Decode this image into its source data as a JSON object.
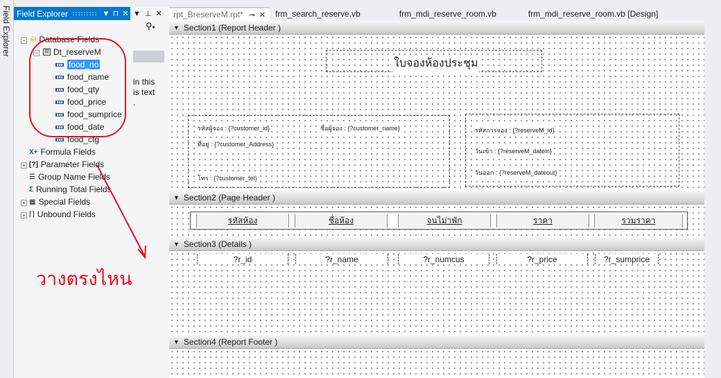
{
  "side_tab": {
    "label": "Field Explorer"
  },
  "field_explorer": {
    "title": "Field Explorer",
    "database_fields": "Database Fields",
    "table": "Dt_reserveM",
    "fields": [
      "food_no",
      "food_name",
      "food_qty",
      "food_price",
      "food_sumprice",
      "food_date",
      "food_ctg"
    ],
    "formula_fields": "Formula Fields",
    "parameter_fields": "Parameter Fields",
    "group_name_fields": "Group Name Fields",
    "running_total_fields": "Running Total Fields",
    "special_fields": "Special Fields",
    "unbound_fields": "Unbound Fields"
  },
  "annotation": {
    "text": "วางตรงไหน",
    "color": "#e81123"
  },
  "middle_panel": {
    "text_lines": "in this\nis text\n."
  },
  "tabs": [
    {
      "label": "rpt_BreserveM.rpt*",
      "active": true
    },
    {
      "label": "frm_search_reserve.vb"
    },
    {
      "label": "frm_mdi_reserve_room.vb"
    },
    {
      "label": "frm_mdi_reserve_room.vb [Design]"
    }
  ],
  "sections": {
    "s1": "Section1 (Report Header  )",
    "s2": "Section2 (Page Header  )",
    "s3": "Section3 (Details  )",
    "s4": "Section4 (Report Footer  )"
  },
  "report_header": {
    "title": "ใบจองห้องประชุม",
    "customer_id_label": "รหัสผู้จอง  :",
    "customer_id": "{?customer_id}",
    "customer_name_label": "ชื่อผู้จอง  :",
    "customer_name": "{?customer_name}",
    "address_label": "ที่อยู่  :",
    "address": "{?customer_Address}",
    "tel_label": "โทร  :",
    "tel": "{?customer_tel}",
    "reserve_id_label": "รหัสการจอง  :",
    "reserve_id": "{?reserveM_id}",
    "datein_label": "วันเข้า  :",
    "datein": "{?reserveM_datein}",
    "dateout_label": "วันออก  :",
    "dateout": "{?reserveM_dateout}"
  },
  "page_header": [
    "รหัสห้อง",
    "ชื่อห้อง",
    "จนไม่าพัก",
    "ราคา",
    "รวมราคา"
  ],
  "details": [
    "?r_id",
    "?r_name",
    "?r_numcus",
    "?r_price",
    "?r_sumprice"
  ],
  "colors": {
    "accent": "#007acc",
    "selection": "#3399ff",
    "annotation": "#e81123"
  }
}
